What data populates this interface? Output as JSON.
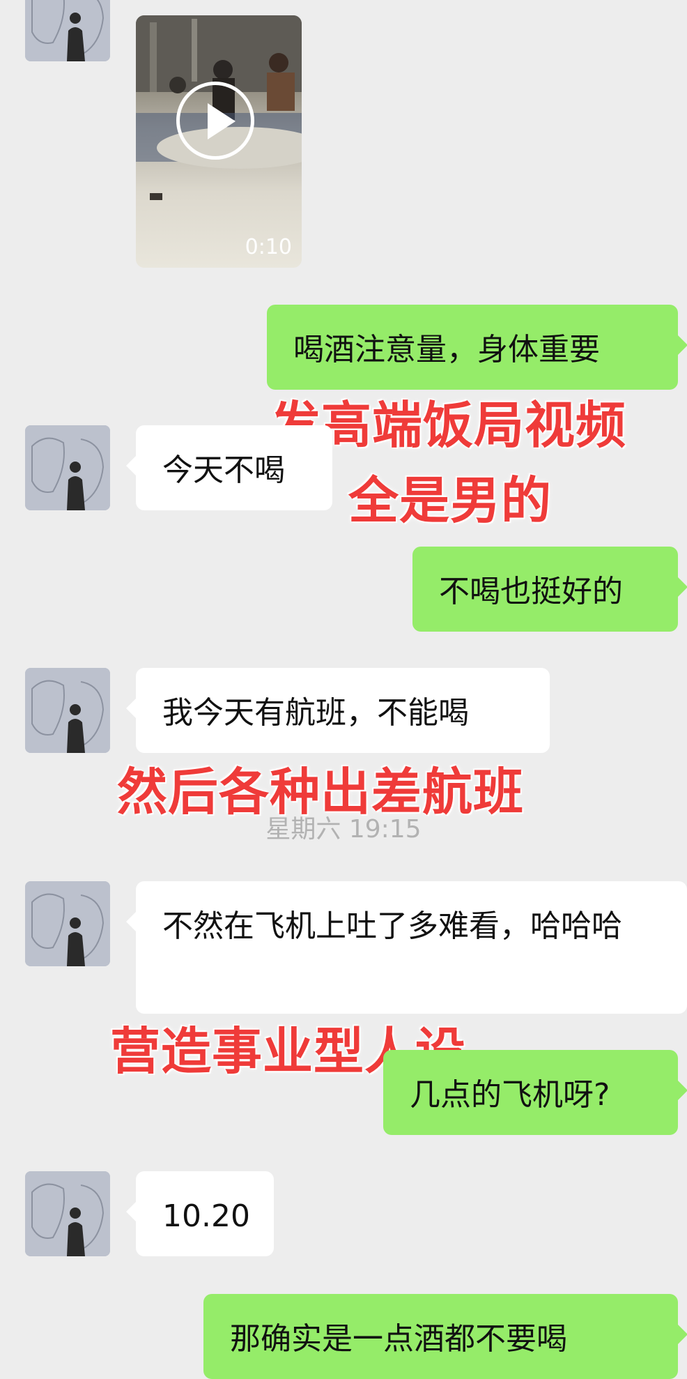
{
  "video": {
    "duration": "0:10"
  },
  "messages": [
    {
      "text": "喝酒注意量，身体重要"
    },
    {
      "text": "今天不喝"
    },
    {
      "text": "不喝也挺好的"
    },
    {
      "text": "我今天有航班，不能喝"
    },
    {
      "text": "不然在飞机上吐了多难看，哈哈哈"
    },
    {
      "text": "几点的飞机呀?"
    },
    {
      "text": "10.20"
    },
    {
      "text": "那确实是一点酒都不要喝"
    }
  ],
  "timestamp": "星期六 19:15",
  "annotations": [
    {
      "text": "发高端饭局视频"
    },
    {
      "text": "全是男的"
    },
    {
      "text": "然后各种出差航班"
    },
    {
      "text": "营造事业型人设"
    }
  ],
  "colors": {
    "outgoing_bubble": "#95ec69",
    "incoming_bubble": "#ffffff",
    "annotation": "#ef3b39",
    "background": "#ededed"
  }
}
